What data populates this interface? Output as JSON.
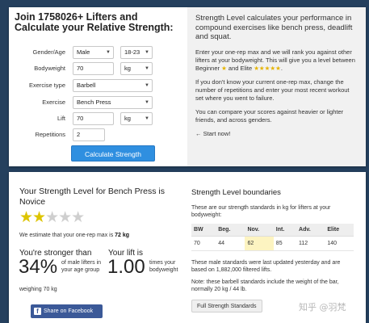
{
  "form": {
    "title": "Join 1758026+ Lifters and Calculate your Relative Strength:",
    "gender_label": "Gender/Age",
    "gender_value": "Male",
    "age_value": "18-23",
    "bodyweight_label": "Bodyweight",
    "bodyweight_value": "70",
    "bodyweight_unit": "kg",
    "exercise_type_label": "Exercise type",
    "exercise_type_value": "Barbell",
    "exercise_label": "Exercise",
    "exercise_value": "Bench Press",
    "lift_label": "Lift",
    "lift_value": "70",
    "lift_unit": "kg",
    "reps_label": "Repetitions",
    "reps_value": "2",
    "calc_button": "Calculate Strength"
  },
  "info": {
    "intro": "Strength Level calculates your performance in compound exercises like bench press, deadlift and squat.",
    "p1_a": "Enter your one-rep max and we will rank you against other lifters at your bodyweight. This will give you a level between Beginner ",
    "p1_star1": "★",
    "p1_b": " and Elite ",
    "p1_star5": "★★★★★",
    "p1_c": ".",
    "p2": "If you don't know your current one-rep max, change the number of repetitions and enter your most recent workout set where you went to failure.",
    "p3": "You can compare your scores against heavier or lighter friends, and across genders.",
    "start": "← Start now!"
  },
  "result": {
    "title": "Your Strength Level for Bench Press is Novice",
    "stars_on": "★★",
    "stars_off": "★★★",
    "star_rating": 2,
    "star_max": 5,
    "estimate_prefix": "We estimate that your one-rep max is ",
    "estimate_value": "72 kg",
    "stronger_heading": "You're stronger than",
    "lift_heading": "Your lift is",
    "percent": "34%",
    "percent_desc": "of male lifters in your age group",
    "multiple": "1.00",
    "multiple_desc": "times your bodyweight",
    "weighing": "weighing 70 kg",
    "share": "Share on Facebook"
  },
  "boundaries": {
    "title": "Strength Level boundaries",
    "desc": "These are our strength standards in kg for lifters at your bodyweight:",
    "headers": [
      "BW",
      "Beg.",
      "Nov.",
      "Int.",
      "Adv.",
      "Elite"
    ],
    "row": [
      "70",
      "44",
      "62",
      "85",
      "112",
      "140"
    ],
    "note1": "These male standards were last updated yesterday and are based on 1,882,000 filtered lifts.",
    "note2": "Note: these barbell standards include the weight of the bar, normally 20 kg / 44 lb.",
    "full_button": "Full Strength Standards"
  },
  "watermark": "知乎 @羽梵",
  "colors": {
    "background": "#25405e",
    "accent_button": "#2f8fe0",
    "facebook": "#3b5998",
    "star": "#ddc400",
    "highlight": "#fdf4c1"
  }
}
